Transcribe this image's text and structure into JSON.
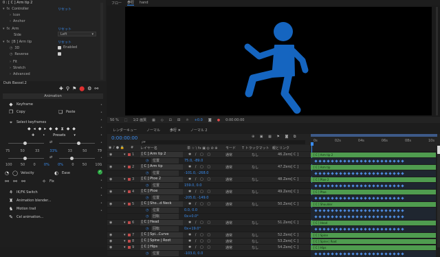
{
  "effects": {
    "header": "0 : [ C ] Arm tip 2",
    "controller": {
      "label": "Controller",
      "reset": "リセット"
    },
    "icon": "Icon",
    "anchor": "Anchor",
    "arm": {
      "label": "Arm",
      "reset": "リセット"
    },
    "side": {
      "label": "Side",
      "value": "Left"
    },
    "armtip": {
      "label": "[B ] Arm tip",
      "reset": "リセット"
    },
    "sub_3d": {
      "label": "3D",
      "value": "Enabled"
    },
    "reverse": "Reverse",
    "fit": "Fit",
    "stretch": "Stretch",
    "advanced": "Advanced"
  },
  "duik": {
    "title": "Duik Bassel.2",
    "section": "Animation",
    "tools": {
      "keyframe": "Keyframe",
      "copy": "Copy",
      "paste": "Paste",
      "select_keyframes": "Select keyframes",
      "presets": "Presets",
      "velocity": "Velocity",
      "ease": "Ease",
      "fix": "Fix",
      "ik_fk_switch": "IK/FK Switch",
      "animation_blender": "Animation blender...",
      "motion_trail": "Motion trail",
      "cel_animation": "Cel animation..."
    },
    "slider1_ticks": [
      "75",
      "50",
      "33",
      "33%",
      "33",
      "50",
      "75"
    ],
    "slider2_ticks": [
      "100",
      "50",
      "0",
      "0%",
      "0%",
      "0",
      "50",
      "100"
    ]
  },
  "comp": {
    "tabs": {
      "flow": "フロー",
      "comp": "歩行",
      "sub": "hand"
    },
    "bottom": {
      "zoom": "50 %",
      "resolution": "1/2 画質",
      "timecode": "0:00:00:00",
      "exposure": "+0.0"
    }
  },
  "timeline": {
    "tabs": [
      "レンダーキュー",
      "ノーマル",
      "歩行 ✕",
      "ノーマル 2"
    ],
    "timecode": "0:00:00:00",
    "search_placeholder": "ρ▾",
    "headers": {
      "num": "#",
      "layer": "レイヤー名",
      "switches": "単 ☆ \\ fx ▣ ◎ ⊘ ⊕",
      "mode": "モード",
      "trkmat": "T トラックマット",
      "parent": "親とリンク"
    },
    "ruler": [
      "0s",
      "02s",
      "04s",
      "06s",
      "08s",
      "10s"
    ],
    "rows": [
      {
        "kind": "layer",
        "num": "1",
        "name": "[ C ] Arm tip 2",
        "mode": "通常",
        "parent": "46.Zero[ C ]",
        "bar": "[ C ] Arm tip 2"
      },
      {
        "kind": "sub",
        "name": "位置",
        "value": "75.0, -89.0"
      },
      {
        "kind": "layer",
        "num": "2",
        "name": "[ C ] Arm tip",
        "mode": "通常",
        "parent": "47.Zero[ C ]",
        "bar": "[ C ] Arm tip"
      },
      {
        "kind": "sub",
        "name": "位置",
        "value": "-101.0, -268.0"
      },
      {
        "kind": "layer",
        "num": "3",
        "name": "[ C ] Ptoe 2",
        "mode": "通常",
        "parent": "48.Zero[ C ]",
        "bar": "[ C ] Ptoe 2"
      },
      {
        "kind": "sub",
        "name": "位置",
        "value": "159.0, 0.0"
      },
      {
        "kind": "layer",
        "num": "4",
        "name": "[ C ] Ptoe",
        "mode": "通常",
        "parent": "49.Zero[ C ]",
        "bar": "[ C ] Ptoe"
      },
      {
        "kind": "sub",
        "name": "位置",
        "value": "-205.0, -149.0"
      },
      {
        "kind": "layer",
        "num": "5",
        "name": "[ C ] Sho...d Neck",
        "mode": "通常",
        "parent": "50.Zero[ C ]",
        "bar": "[ C ] Shoulder"
      },
      {
        "kind": "sub",
        "name": "位置",
        "value": "0.0, 0.0"
      },
      {
        "kind": "sub",
        "name": "回転",
        "value": "0x+0.0°"
      },
      {
        "kind": "layer",
        "num": "6",
        "name": "[ C ] Head",
        "mode": "通常",
        "parent": "51.Zero[ C ]",
        "bar": "[ C ] Head"
      },
      {
        "kind": "sub",
        "name": "回転",
        "value": "0x+19.0°"
      },
      {
        "kind": "layer",
        "num": "7",
        "name": "[ C ] Spi...Curve",
        "mode": "通常",
        "parent": "52.Zero[ C ]",
        "bar": "[ C ] Spine"
      },
      {
        "kind": "layer",
        "num": "8",
        "name": "[ C ] Spine | Root",
        "mode": "通常",
        "parent": "53.Zero[ C ]",
        "bar": "[ C ] Spine | Root"
      },
      {
        "kind": "layer",
        "num": "9",
        "name": "[ C ] Hips",
        "mode": "通常",
        "parent": "54.Zero[ C ]",
        "bar": "[ C ] Hips"
      },
      {
        "kind": "sub",
        "name": "位置",
        "value": "-103.0, 0.0"
      }
    ],
    "parent_none": "なし"
  },
  "colors": {
    "accent": "#2f8fe0",
    "figure": "#1565c0",
    "bar_green": "#4f9c4f"
  }
}
